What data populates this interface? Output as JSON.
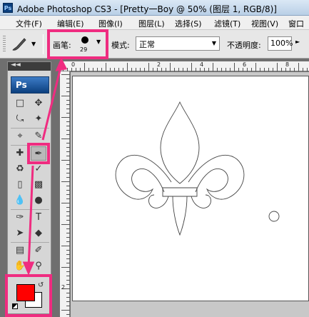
{
  "window": {
    "title": "Adobe Photoshop CS3 - [Pretty一Boy @ 50% (图层 1, RGB/8)]",
    "app_icon": "Ps"
  },
  "menu": [
    "文件(F)",
    "编辑(E)",
    "图像(I)",
    "图层(L)",
    "选择(S)",
    "滤镜(T)",
    "视图(V)",
    "窗口"
  ],
  "options": {
    "brush_label": "画笔:",
    "brush_size": "29",
    "mode_label": "模式:",
    "mode_value": "正常",
    "opacity_label": "不透明度:",
    "opacity_value": "100%"
  },
  "toolbox": {
    "logo": "Ps",
    "collapse_arrows": "◄◄"
  },
  "colors": {
    "foreground": "#ff0000",
    "background": "#ffffff",
    "highlight": "#ef2c80"
  },
  "rulers": {
    "top_labels": [
      "0",
      "2",
      "4",
      "6",
      "8"
    ],
    "left_labels": [
      "2"
    ]
  }
}
